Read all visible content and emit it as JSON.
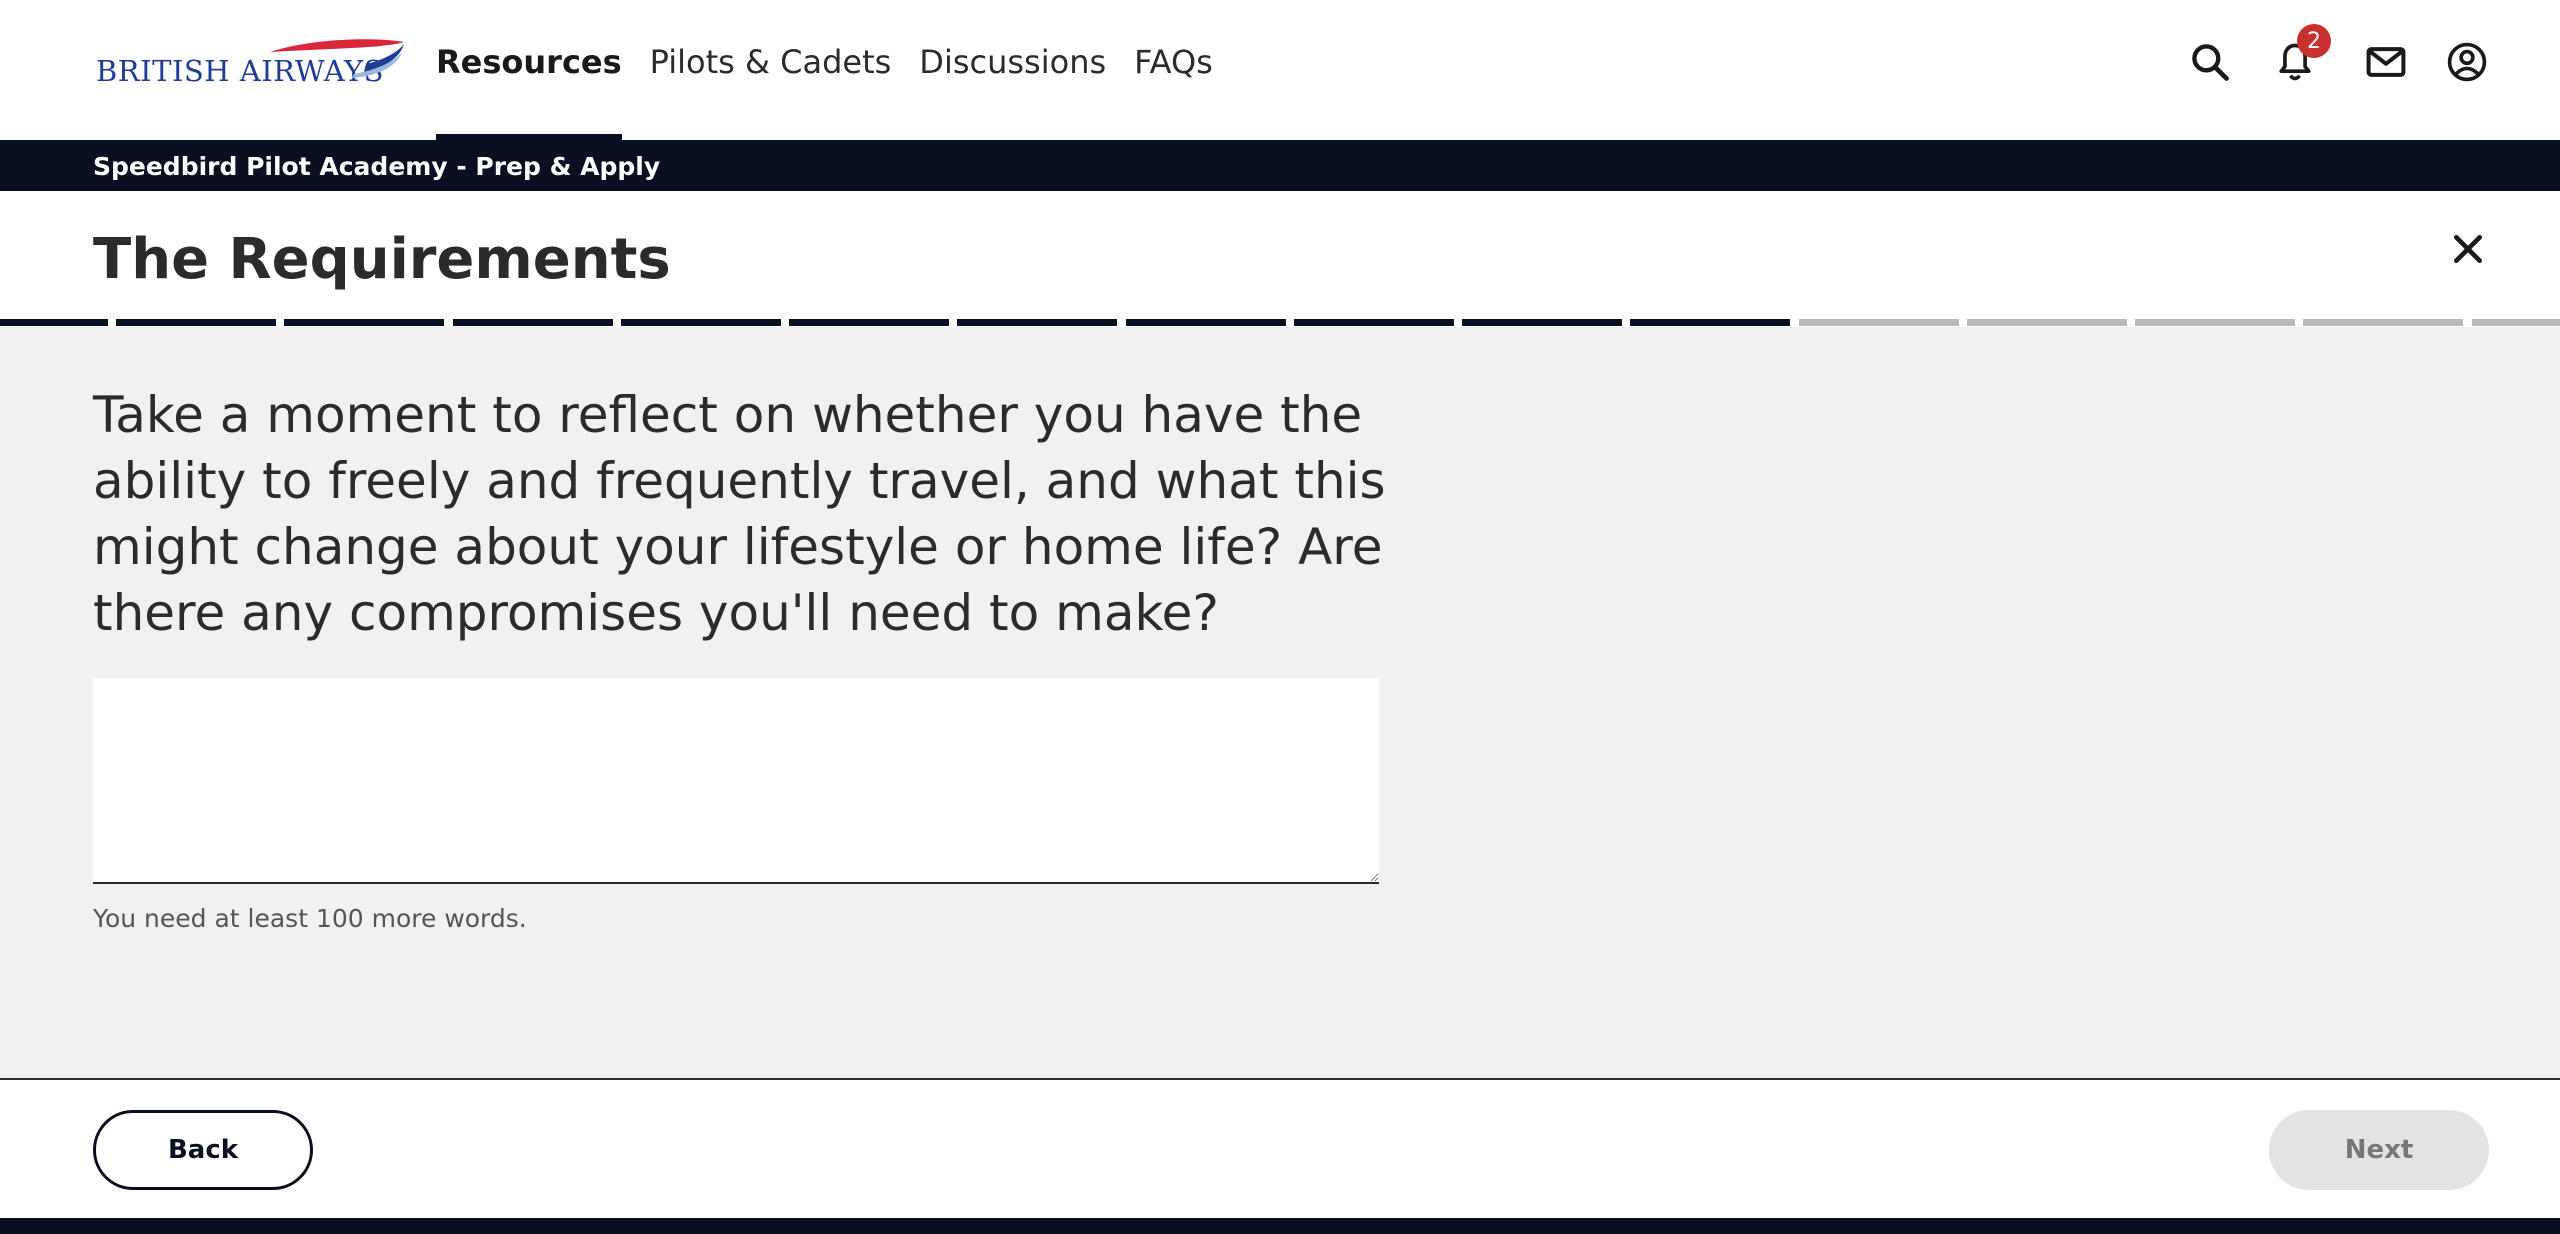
{
  "header": {
    "logo_text": "BRITISH AIRWAYS",
    "nav": [
      {
        "label": "Resources",
        "active": true
      },
      {
        "label": "Pilots & Cadets",
        "active": false
      },
      {
        "label": "Discussions",
        "active": false
      },
      {
        "label": "FAQs",
        "active": false
      }
    ],
    "icons": {
      "search": "search-icon",
      "notifications": "bell-icon",
      "notification_count": "2",
      "messages": "mail-icon",
      "profile": "user-circle-icon"
    }
  },
  "breadcrumb": "Speedbird Pilot Academy - Prep & Apply",
  "page": {
    "title": "The Requirements",
    "close_icon": "close-icon",
    "progress": {
      "total_steps": 16,
      "completed_steps": 11
    }
  },
  "question": {
    "text": "Take a moment to reflect on whether you have the ability to freely and frequently travel, and what this might change about your lifestyle or home life? Are there any compromises you'll need to make?",
    "answer_value": "",
    "hint": "You need at least 100 more words."
  },
  "footer": {
    "back_label": "Back",
    "next_label": "Next"
  },
  "colors": {
    "navy": "#091022",
    "progress_done": "#091022",
    "progress_todo": "#b9b9be",
    "badge": "#c8312f",
    "logo_blue": "#1f3c96",
    "logo_red": "#d9263a"
  }
}
